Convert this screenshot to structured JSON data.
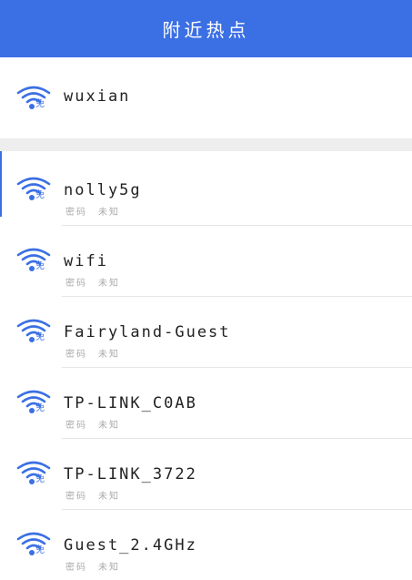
{
  "header": {
    "title": "附近热点"
  },
  "icon": {
    "name": "wifi-free-icon",
    "color": "#3b6fe4",
    "badge": "免"
  },
  "connected": {
    "ssid": "wuxian"
  },
  "networks": [
    {
      "ssid": "nolly5g",
      "security_label": "密码",
      "security_value": "未知"
    },
    {
      "ssid": "wifi",
      "security_label": "密码",
      "security_value": "未知"
    },
    {
      "ssid": "Fairyland-Guest",
      "security_label": "密码",
      "security_value": "未知"
    },
    {
      "ssid": "TP-LINK_C0AB",
      "security_label": "密码",
      "security_value": "未知"
    },
    {
      "ssid": "TP-LINK_3722",
      "security_label": "密码",
      "security_value": "未知"
    },
    {
      "ssid": "Guest_2.4GHz",
      "security_label": "密码",
      "security_value": "未知"
    }
  ],
  "colors": {
    "accent": "#3b6fe4",
    "divider": "#eeeeee"
  }
}
